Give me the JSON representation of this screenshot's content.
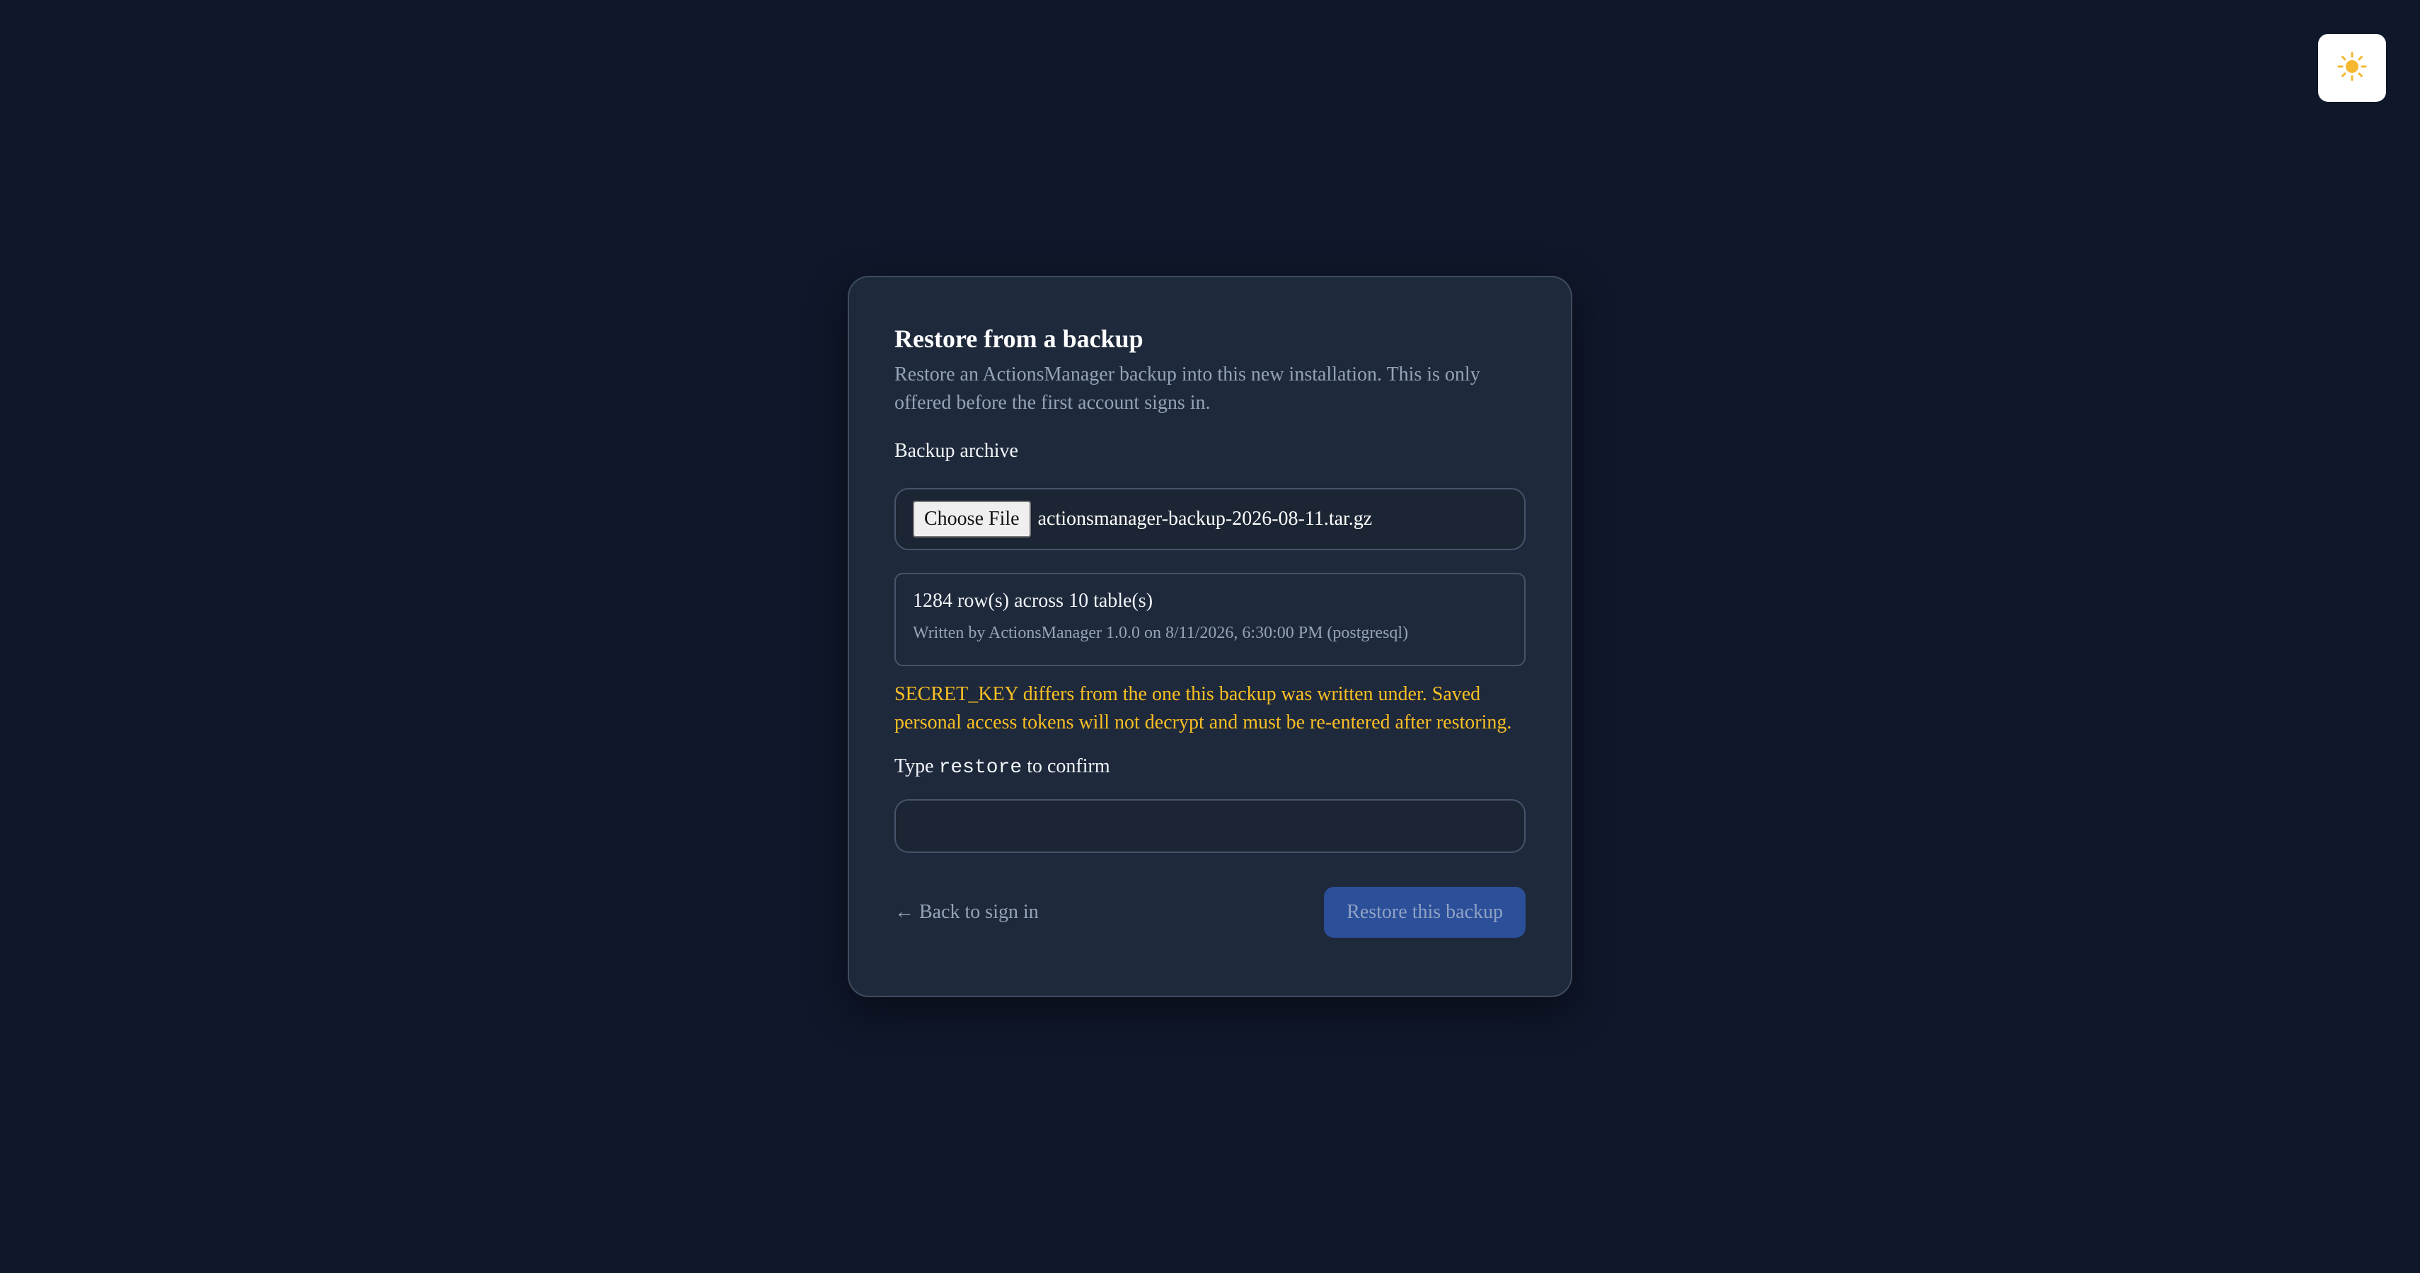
{
  "theme_toggle": {
    "icon": "sun-icon",
    "glyph": "☀️"
  },
  "card": {
    "title": "Restore from a backup",
    "subtitle": "Restore an ActionsManager backup into this new installation. This is only offered before the first account signs in."
  },
  "archive": {
    "label": "Backup archive",
    "choose_label": "Choose File",
    "file_name": "actionsmanager-backup-2026-08-11.tar.gz"
  },
  "summary": {
    "rows_tables": "1284 row(s) across 10 table(s)",
    "written_by": "Written by ActionsManager 1.0.0 on 8/11/2026, 6:30:00 PM (postgresql)"
  },
  "warning": "SECRET_KEY differs from the one this backup was written under. Saved personal access tokens will not decrypt and must be re-entered after restoring.",
  "confirm": {
    "prefix": "Type ",
    "keyword": "restore",
    "suffix": " to confirm",
    "value": "",
    "placeholder": ""
  },
  "actions": {
    "back_arrow": "←",
    "back_label": "Back to sign in",
    "restore_label": "Restore this backup"
  },
  "colors": {
    "background": "#0f172a",
    "card": "#1e293b",
    "warning": "#fbbf24",
    "primary": "#2b4f99"
  }
}
